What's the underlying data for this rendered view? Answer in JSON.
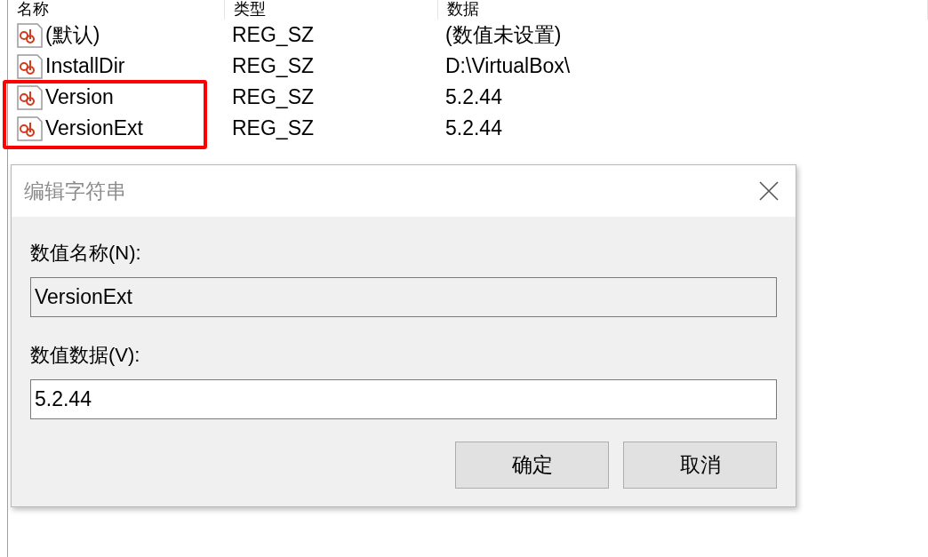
{
  "columns": [
    "名称",
    "类型",
    "数据"
  ],
  "rows": [
    {
      "name": "(默认)",
      "type": "REG_SZ",
      "data": "(数值未设置)"
    },
    {
      "name": "InstallDir",
      "type": "REG_SZ",
      "data": "D:\\VirtualBox\\"
    }
  ],
  "boxed_rows": [
    {
      "name": "Version",
      "type": "REG_SZ",
      "data": "5.2.44"
    },
    {
      "name": "VersionExt",
      "type": "REG_SZ",
      "data": "5.2.44"
    }
  ],
  "dialog": {
    "title": "编辑字符串",
    "name_label": "数值名称(N):",
    "name_value": "VersionExt",
    "data_label": "数值数据(V):",
    "data_value": "5.2.44",
    "buttons": [
      "确定",
      "取消"
    ]
  }
}
